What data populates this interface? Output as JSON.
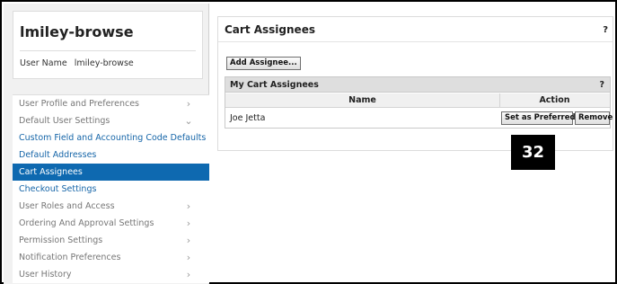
{
  "user": {
    "title": "lmiley-browse",
    "name_label": "User Name",
    "name_value": "lmiley-browse"
  },
  "sidebar": {
    "items": [
      {
        "label": "User Profile and Preferences",
        "chevron": "chevron-right-icon"
      },
      {
        "label": "Default User Settings",
        "chevron": "chevron-down-icon"
      },
      {
        "label": "Custom Field and Accounting Code Defaults"
      },
      {
        "label": "Default Addresses"
      },
      {
        "label": "Cart Assignees",
        "active": true
      },
      {
        "label": "Checkout Settings"
      },
      {
        "label": "User Roles and Access",
        "chevron": "chevron-right-icon"
      },
      {
        "label": "Ordering And Approval Settings",
        "chevron": "chevron-right-icon"
      },
      {
        "label": "Permission Settings",
        "chevron": "chevron-right-icon"
      },
      {
        "label": "Notification Preferences",
        "chevron": "chevron-right-icon"
      },
      {
        "label": "User History",
        "chevron": "chevron-right-icon"
      }
    ]
  },
  "content": {
    "title": "Cart Assignees",
    "help": "?",
    "add_button": "Add Assignee...",
    "grid": {
      "title": "My Cart Assignees",
      "help": "?",
      "columns": [
        "Name",
        "Action"
      ],
      "rows": [
        {
          "name": "Joe Jetta",
          "actions": [
            "Set as Preferred",
            "Remove"
          ]
        }
      ]
    }
  },
  "callout": {
    "number": "32"
  },
  "colors": {
    "active_bg": "#0e69b0",
    "link": "#1565a8",
    "sidebar_bg": "#f1f1f1"
  }
}
